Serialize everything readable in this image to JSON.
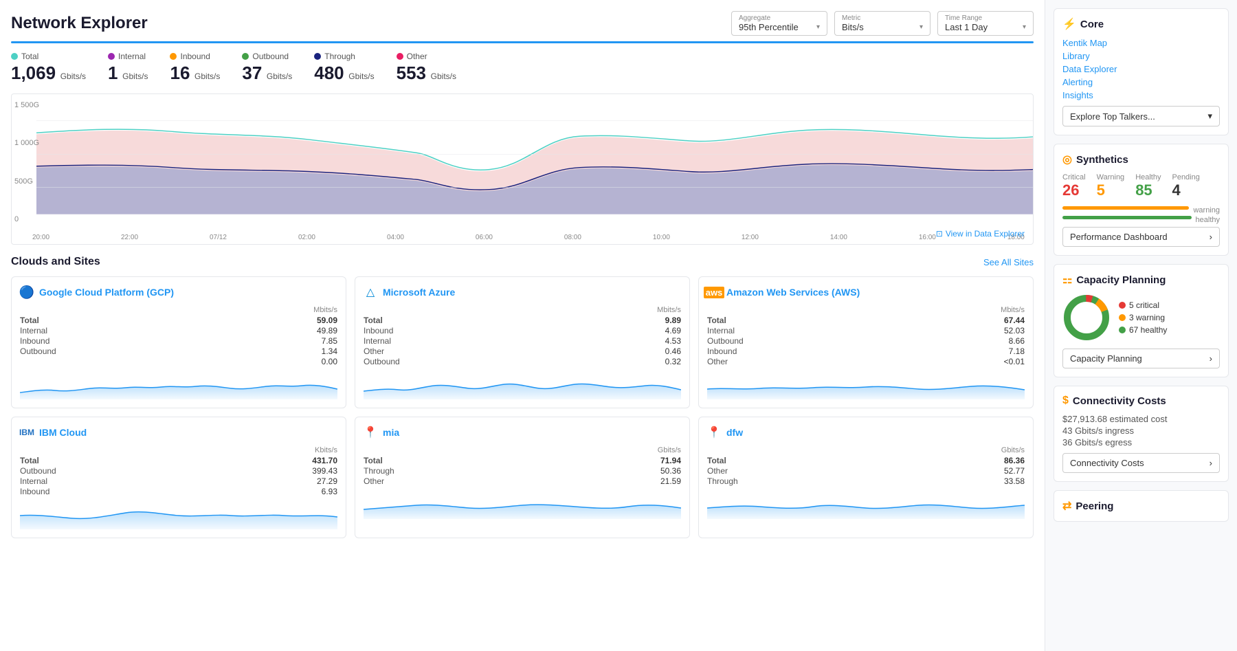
{
  "header": {
    "title": "Network Explorer",
    "aggregate_label": "Aggregate",
    "aggregate_value": "95th Percentile",
    "metric_label": "Metric",
    "metric_value": "Bits/s",
    "time_range_label": "Time Range",
    "time_range_value": "Last 1 Day"
  },
  "metrics": [
    {
      "label": "Total",
      "value": "1,069",
      "unit": "Gbits/s",
      "color": "#4dd0c4"
    },
    {
      "label": "Internal",
      "value": "1",
      "unit": "Gbits/s",
      "color": "#9c27b0"
    },
    {
      "label": "Inbound",
      "value": "16",
      "unit": "Gbits/s",
      "color": "#ff9800"
    },
    {
      "label": "Outbound",
      "value": "37",
      "unit": "Gbits/s",
      "color": "#43a047"
    },
    {
      "label": "Through",
      "value": "480",
      "unit": "Gbits/s",
      "color": "#1a237e"
    },
    {
      "label": "Other",
      "value": "553",
      "unit": "Gbits/s",
      "color": "#e91e63"
    }
  ],
  "chart": {
    "y_labels": [
      "1 500G",
      "1 000G",
      "500G",
      "0"
    ],
    "x_labels": [
      "20:00",
      "22:00",
      "07/12",
      "02:00",
      "04:00",
      "06:00",
      "08:00",
      "10:00",
      "12:00",
      "14:00",
      "16:00",
      "18:00"
    ],
    "view_data_explorer": "View in Data Explorer"
  },
  "clouds_section": {
    "title": "Clouds and Sites",
    "see_all": "See All Sites",
    "cards": [
      {
        "id": "gcp",
        "name": "Google Cloud Platform (GCP)",
        "logo": "gcp",
        "unit": "Mbits/s",
        "rows": [
          {
            "label": "Total",
            "value": "59.09",
            "bold": true
          },
          {
            "label": "Internal",
            "value": "49.89"
          },
          {
            "label": "Inbound",
            "value": "7.85"
          },
          {
            "label": "Outbound",
            "value": "1.34"
          },
          {
            "label": "",
            "value": "0.00"
          }
        ]
      },
      {
        "id": "azure",
        "name": "Microsoft Azure",
        "logo": "azure",
        "unit": "Mbits/s",
        "rows": [
          {
            "label": "Total",
            "value": "9.89",
            "bold": true
          },
          {
            "label": "Inbound",
            "value": "4.69"
          },
          {
            "label": "Internal",
            "value": "4.53"
          },
          {
            "label": "Other",
            "value": "0.46"
          },
          {
            "label": "Outbound",
            "value": "0.32"
          }
        ]
      },
      {
        "id": "aws",
        "name": "Amazon Web Services (AWS)",
        "logo": "aws",
        "unit": "Mbits/s",
        "rows": [
          {
            "label": "Total",
            "value": "67.44",
            "bold": true
          },
          {
            "label": "Internal",
            "value": "52.03"
          },
          {
            "label": "Outbound",
            "value": "8.66"
          },
          {
            "label": "Inbound",
            "value": "7.18"
          },
          {
            "label": "Other",
            "value": "<0.01"
          }
        ]
      },
      {
        "id": "ibm",
        "name": "IBM Cloud",
        "logo": "ibm",
        "unit": "Kbits/s",
        "rows": [
          {
            "label": "Total",
            "value": "431.70",
            "bold": true
          },
          {
            "label": "Outbound",
            "value": "399.43"
          },
          {
            "label": "Internal",
            "value": "27.29"
          },
          {
            "label": "Inbound",
            "value": "6.93"
          }
        ]
      },
      {
        "id": "mia",
        "name": "mia",
        "logo": "location",
        "unit": "Gbits/s",
        "rows": [
          {
            "label": "Total",
            "value": "71.94",
            "bold": true
          },
          {
            "label": "Through",
            "value": "50.36"
          },
          {
            "label": "Other",
            "value": "21.59"
          }
        ]
      },
      {
        "id": "dfw",
        "name": "dfw",
        "logo": "location",
        "unit": "Gbits/s",
        "rows": [
          {
            "label": "Total",
            "value": "86.36",
            "bold": true
          },
          {
            "label": "Other",
            "value": "52.77"
          },
          {
            "label": "Through",
            "value": "33.58"
          }
        ]
      }
    ]
  },
  "sidebar": {
    "core": {
      "title": "Core",
      "icon": "⚡",
      "links": [
        "Kentik Map",
        "Library",
        "Data Explorer",
        "Alerting",
        "Insights"
      ],
      "explore_label": "Explore Top Talkers...",
      "insights_label": "Insights"
    },
    "synthetics": {
      "title": "Synthetics",
      "icon": "🔄",
      "critical_label": "Critical",
      "critical_value": "26",
      "warning_label": "Warning",
      "warning_value": "5",
      "healthy_label": "Healthy",
      "healthy_value": "85",
      "pending_label": "Pending",
      "pending_value": "4",
      "perf_dashboard_label": "Performance Dashboard",
      "status_bar": {
        "warning_label": "warning",
        "healthy_label": "healthy"
      }
    },
    "capacity": {
      "title": "Capacity Planning",
      "icon": "📊",
      "critical_count": "5",
      "critical_label": "5 critical",
      "warning_count": "3",
      "warning_label": "3 warning",
      "healthy_count": "67",
      "healthy_label": "67 healthy",
      "btn_label": "Capacity Planning"
    },
    "connectivity": {
      "title": "Connectivity Costs",
      "icon": "$",
      "estimated_cost": "$27,913.68 estimated cost",
      "ingress": "43 Gbits/s ingress",
      "egress": "36 Gbits/s egress",
      "btn_label": "Connectivity Costs"
    },
    "peering": {
      "title": "Peering",
      "icon": "🔀"
    }
  }
}
